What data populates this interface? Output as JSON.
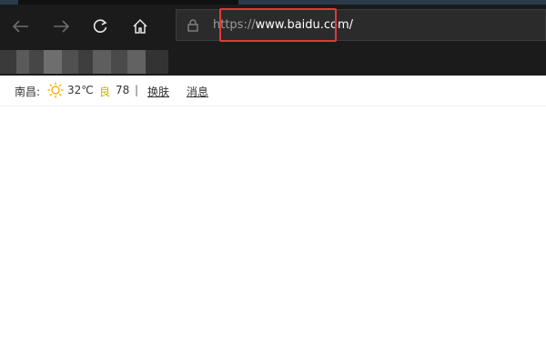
{
  "browser": {
    "url_scheme": "https://",
    "url_host": "www.baidu.com/",
    "nav_icons": [
      "back-arrow-icon",
      "forward-arrow-icon",
      "refresh-icon",
      "home-icon",
      "lock-icon"
    ],
    "highlight_color": "#e03a3a"
  },
  "weather_bar": {
    "city": "南昌:",
    "weather_icon": "sun-icon",
    "temperature": "32℃",
    "air_quality_label": "良",
    "air_quality_value": "78",
    "separator": "|",
    "skin_link": "换肤",
    "messages_link": "消息"
  }
}
